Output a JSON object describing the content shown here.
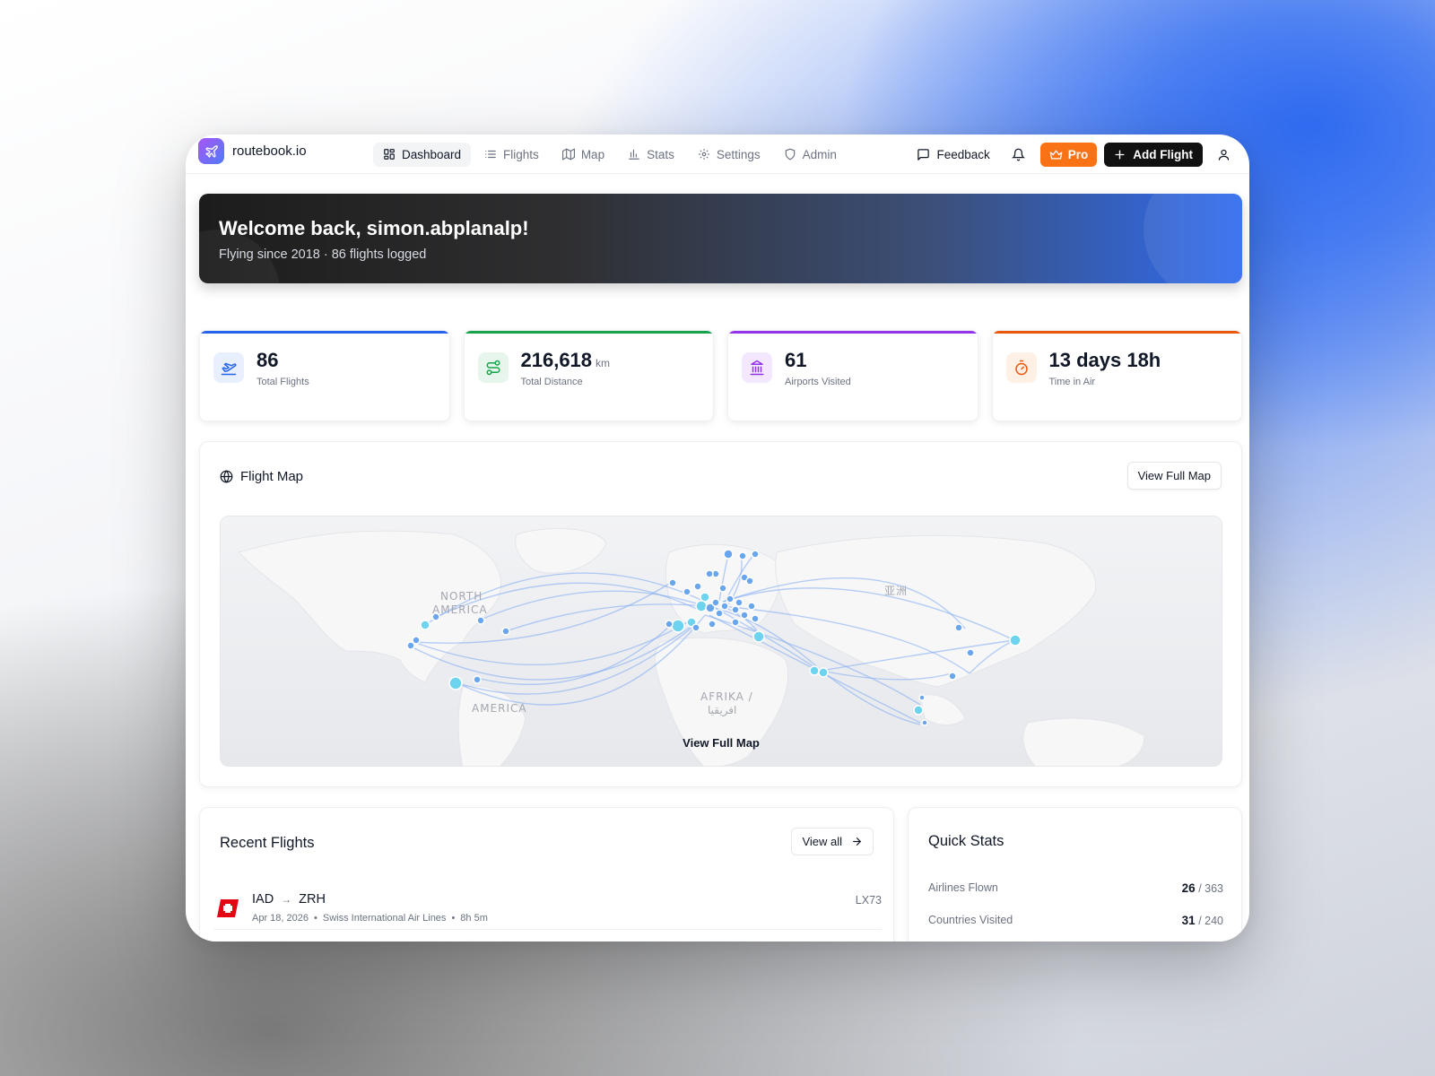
{
  "brand": {
    "name": "routebook.io"
  },
  "nav": {
    "items": [
      {
        "label": "Dashboard",
        "icon": "dashboard-icon",
        "active": true
      },
      {
        "label": "Flights",
        "icon": "list-icon"
      },
      {
        "label": "Map",
        "icon": "map-icon"
      },
      {
        "label": "Stats",
        "icon": "bar-chart-icon"
      },
      {
        "label": "Settings",
        "icon": "gear-icon"
      },
      {
        "label": "Admin",
        "icon": "shield-icon"
      }
    ],
    "feedback_label": "Feedback",
    "pro_label": "Pro",
    "add_flight_label": "Add Flight"
  },
  "hero": {
    "title": "Welcome back, simon.abplanalp!",
    "subtitle": "Flying since 2018 · 86 flights logged"
  },
  "stats": [
    {
      "value": "86",
      "unit": "",
      "label": "Total Flights",
      "color": "#2563eb",
      "bg": "#e8efff"
    },
    {
      "value": "216,618",
      "unit": "km",
      "label": "Total Distance",
      "color": "#16a34a",
      "bg": "#e6f6ec"
    },
    {
      "value": "61",
      "unit": "",
      "label": "Airports Visited",
      "color": "#9333ea",
      "bg": "#f3e8ff"
    },
    {
      "value": "13 days 18h",
      "unit": "",
      "label": "Time in Air",
      "color": "#ea580c",
      "bg": "#fff0e6"
    }
  ],
  "map": {
    "title": "Flight Map",
    "view_full_label": "View Full Map",
    "overlay_label": "View Full Map",
    "regions": [
      "NORTH",
      "AMERICA",
      "AMERICA",
      "AFRIKA /",
      "افريقيا",
      "亚洲"
    ]
  },
  "recent": {
    "title": "Recent Flights",
    "view_all_label": "View all",
    "flights": [
      {
        "from": "IAD",
        "to": "ZRH",
        "date": "Apr 18, 2026",
        "airline": "Swiss International Air Lines",
        "duration": "8h 5m",
        "number": "LX73"
      }
    ]
  },
  "quick_stats": {
    "title": "Quick Stats",
    "rows": [
      {
        "label": "Airlines Flown",
        "value": "26",
        "total": "/ 363"
      },
      {
        "label": "Countries Visited",
        "value": "31",
        "total": "/ 240"
      }
    ]
  }
}
